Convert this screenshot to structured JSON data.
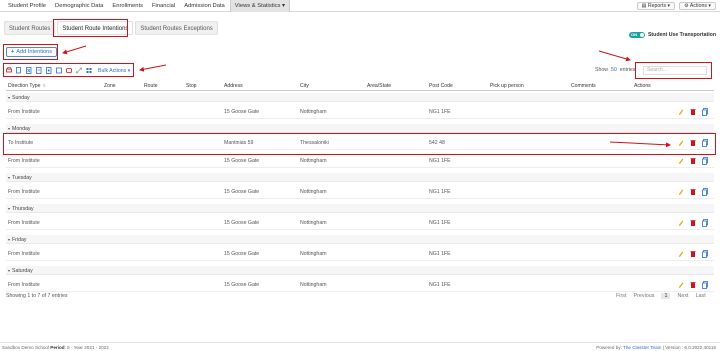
{
  "topnav": {
    "tabs": [
      "Student Profile",
      "Demographic Data",
      "Enrollments",
      "Financial",
      "Admission Data",
      "Views & Statistics ▾"
    ],
    "active_index": 5,
    "reports_label": "▤ Reports ▾",
    "actions_label": "⚙ Actions ▾"
  },
  "subtabs": [
    "Student Routes",
    "Student Route Intentions",
    "Student Routes Exceptions"
  ],
  "subtab_active": 1,
  "transport_toggle": {
    "state": "ON",
    "label": "Student Use Transportation"
  },
  "add_button": {
    "label": "Add Intentions"
  },
  "toolbar": {
    "bulk_label": "Bulk Actions ▾"
  },
  "show_entries": {
    "prefix": "Show",
    "value": "50",
    "suffix": "entries"
  },
  "search": {
    "placeholder": "Search..."
  },
  "columns": [
    "Direction Type",
    "Zone",
    "Route",
    "Stop",
    "Address",
    "City",
    "Area/State",
    "Post Code",
    "Pick up person",
    "Comments",
    "Actions"
  ],
  "groups": [
    {
      "day": "Sunday",
      "rows": [
        {
          "direction": "From Institute",
          "address": "15 Goose Gate",
          "city": "Nottingham",
          "postcode": "NG1 1FE"
        }
      ]
    },
    {
      "day": "Monday",
      "rows": [
        {
          "direction": "To Institute",
          "address": "Mantinias 59",
          "city": "Thessaloniki",
          "postcode": "542 48"
        },
        {
          "direction": "From Institute",
          "address": "15 Goose Gate",
          "city": "Nottingham",
          "postcode": "NG1 1FE"
        }
      ]
    },
    {
      "day": "Tuesday",
      "rows": [
        {
          "direction": "From Institute",
          "address": "15 Goose Gate",
          "city": "Nottingham",
          "postcode": "NG1 1FE"
        }
      ]
    },
    {
      "day": "Thursday",
      "rows": [
        {
          "direction": "From Institute",
          "address": "15 Goose Gate",
          "city": "Nottingham",
          "postcode": "NG1 1FE"
        }
      ]
    },
    {
      "day": "Friday",
      "rows": [
        {
          "direction": "From Institute",
          "address": "15 Goose Gate",
          "city": "Nottingham",
          "postcode": "NG1 1FE"
        }
      ]
    },
    {
      "day": "Saturday",
      "rows": [
        {
          "direction": "From Institute",
          "address": "15 Goose Gate",
          "city": "Nottingham",
          "postcode": "NG1 1FE"
        }
      ]
    }
  ],
  "table_info": "Showing 1 to 7 of 7 entries",
  "pager": {
    "first": "First",
    "previous": "Previous",
    "current": "1",
    "next": "Next",
    "last": "Last"
  },
  "status": {
    "left_prefix": "Sandbox",
    "school": "Demo School",
    "period_label": "Period",
    "period_value": ": 5 - Year 2021 - 2022",
    "powered_by": "Powered by:",
    "team": "The Classter Team",
    "version": "| Version : 6.0.2022.40119"
  },
  "colors": {
    "accent": "#2a6fc9",
    "highlight": "#d0121b",
    "toggle": "#1aa39b"
  }
}
